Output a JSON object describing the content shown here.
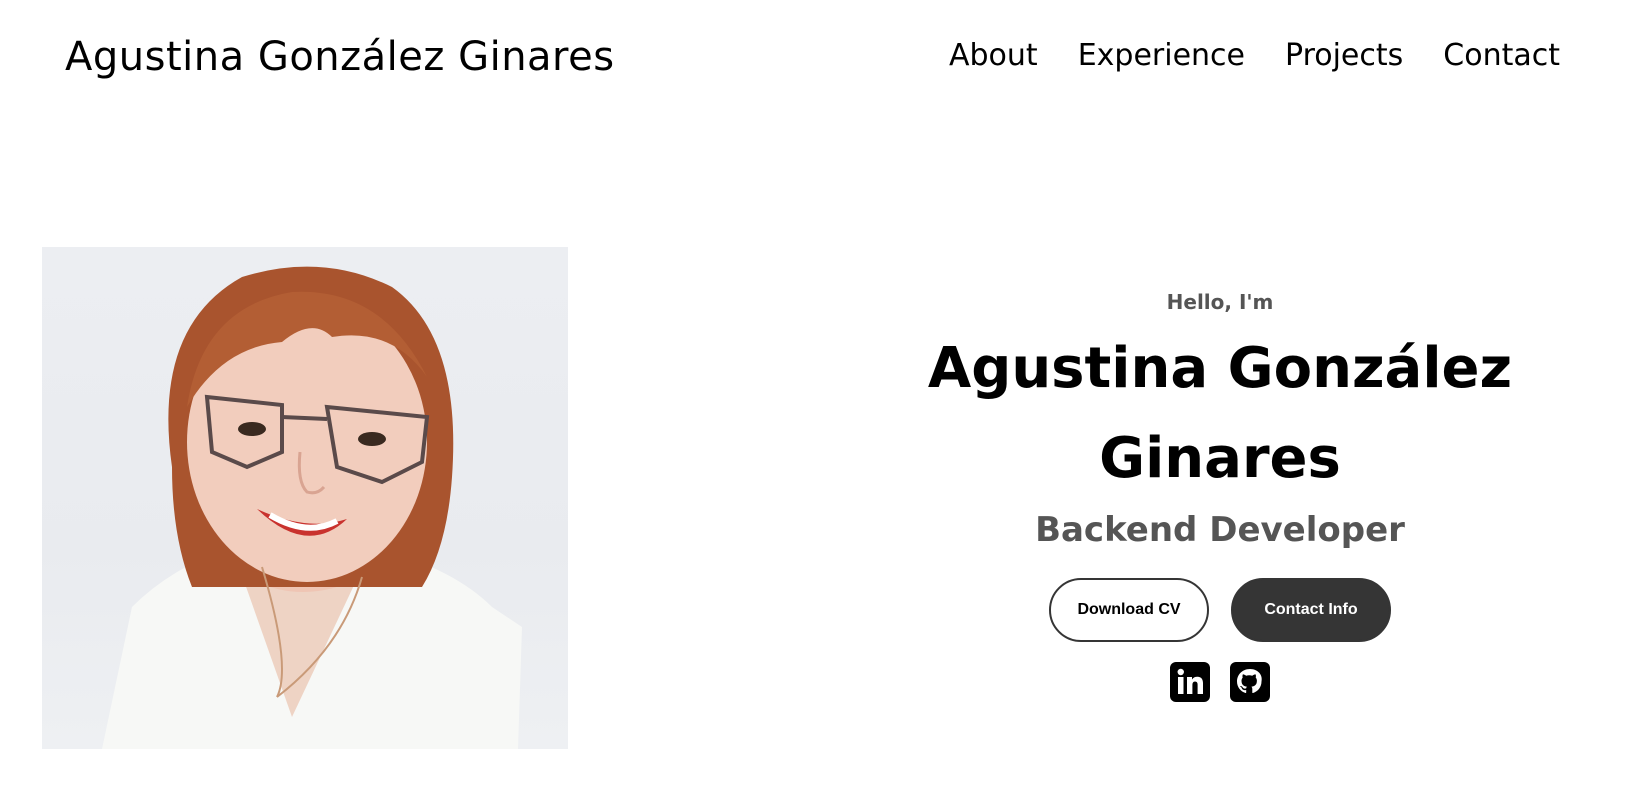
{
  "nav": {
    "logo": "Agustina González Ginares",
    "links": [
      "About",
      "Experience",
      "Projects",
      "Contact"
    ]
  },
  "profile": {
    "greeting": "Hello, I'm",
    "name_line1": "Agustina González",
    "name_line2": "Ginares",
    "role": "Backend Developer",
    "buttons": {
      "download": "Download CV",
      "contact": "Contact Info"
    },
    "socials": [
      "linkedin-icon",
      "github-icon"
    ]
  },
  "colors": {
    "dark_button": "#353535",
    "muted_text": "#555555"
  }
}
